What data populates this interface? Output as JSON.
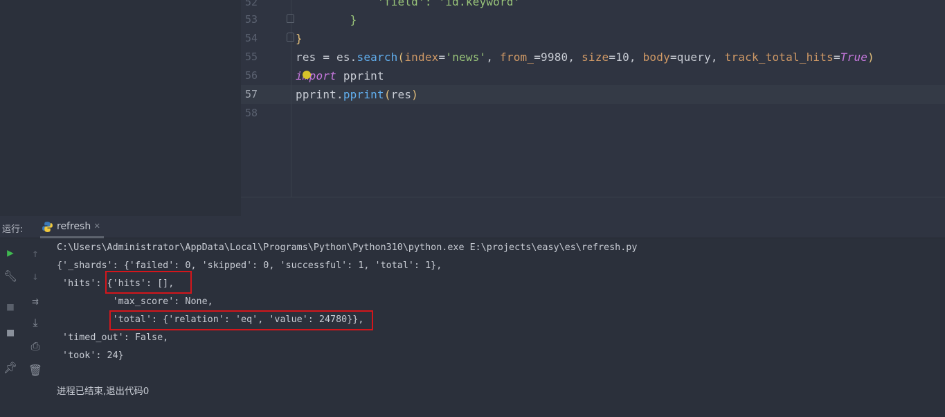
{
  "editor": {
    "lines": [
      {
        "num": "52",
        "code": "            'field': 'id.keyword'"
      },
      {
        "num": "53",
        "code": "        }"
      },
      {
        "num": "54",
        "code": "}"
      },
      {
        "num": "55",
        "code": "res = es.search(index='news', from_=9980, size=10, body=query, track_total_hits=True)"
      },
      {
        "num": "56",
        "code": "import pprint"
      },
      {
        "num": "57",
        "code": "pprint.pprint(res)"
      },
      {
        "num": "58",
        "code": ""
      }
    ]
  },
  "run_panel": {
    "label": "运行:",
    "tab": {
      "label": "refresh",
      "icon": "python-icon"
    },
    "console": [
      "C:\\Users\\Administrator\\AppData\\Local\\Programs\\Python\\Python310\\python.exe E:\\projects\\easy\\es\\refresh.py",
      "{'_shards': {'failed': 0, 'skipped': 0, 'successful': 1, 'total': 1},",
      " 'hits': {'hits': [],",
      "          'max_score': None,",
      "          'total': {'relation': 'eq', 'value': 24780}},",
      " 'timed_out': False,",
      " 'took': 24}",
      "",
      "进程已结束,退出代码0"
    ]
  },
  "colors": {
    "highlight_box": "#d4161b",
    "run": "#3fb950"
  }
}
